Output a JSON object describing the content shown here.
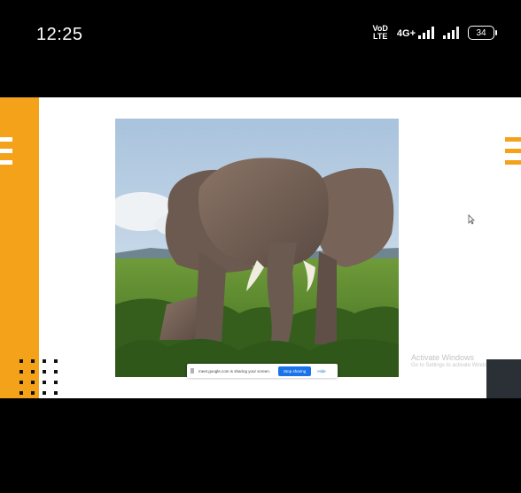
{
  "status_bar": {
    "time": "12:25",
    "volte_line1": "VoD",
    "volte_line2": "LTE",
    "network": "4G+",
    "battery": "34"
  },
  "shared_screen": {
    "activate_windows_title": "Activate Windows",
    "activate_windows_subtitle": "Go to Settings to activate Windows.",
    "share_bar": {
      "message": "meet.google.com is sharing your screen.",
      "stop_label": "Stop sharing",
      "hide_label": "Hide"
    }
  },
  "colors": {
    "accent_orange": "#f5a21b",
    "stop_button_blue": "#1a73e8"
  }
}
